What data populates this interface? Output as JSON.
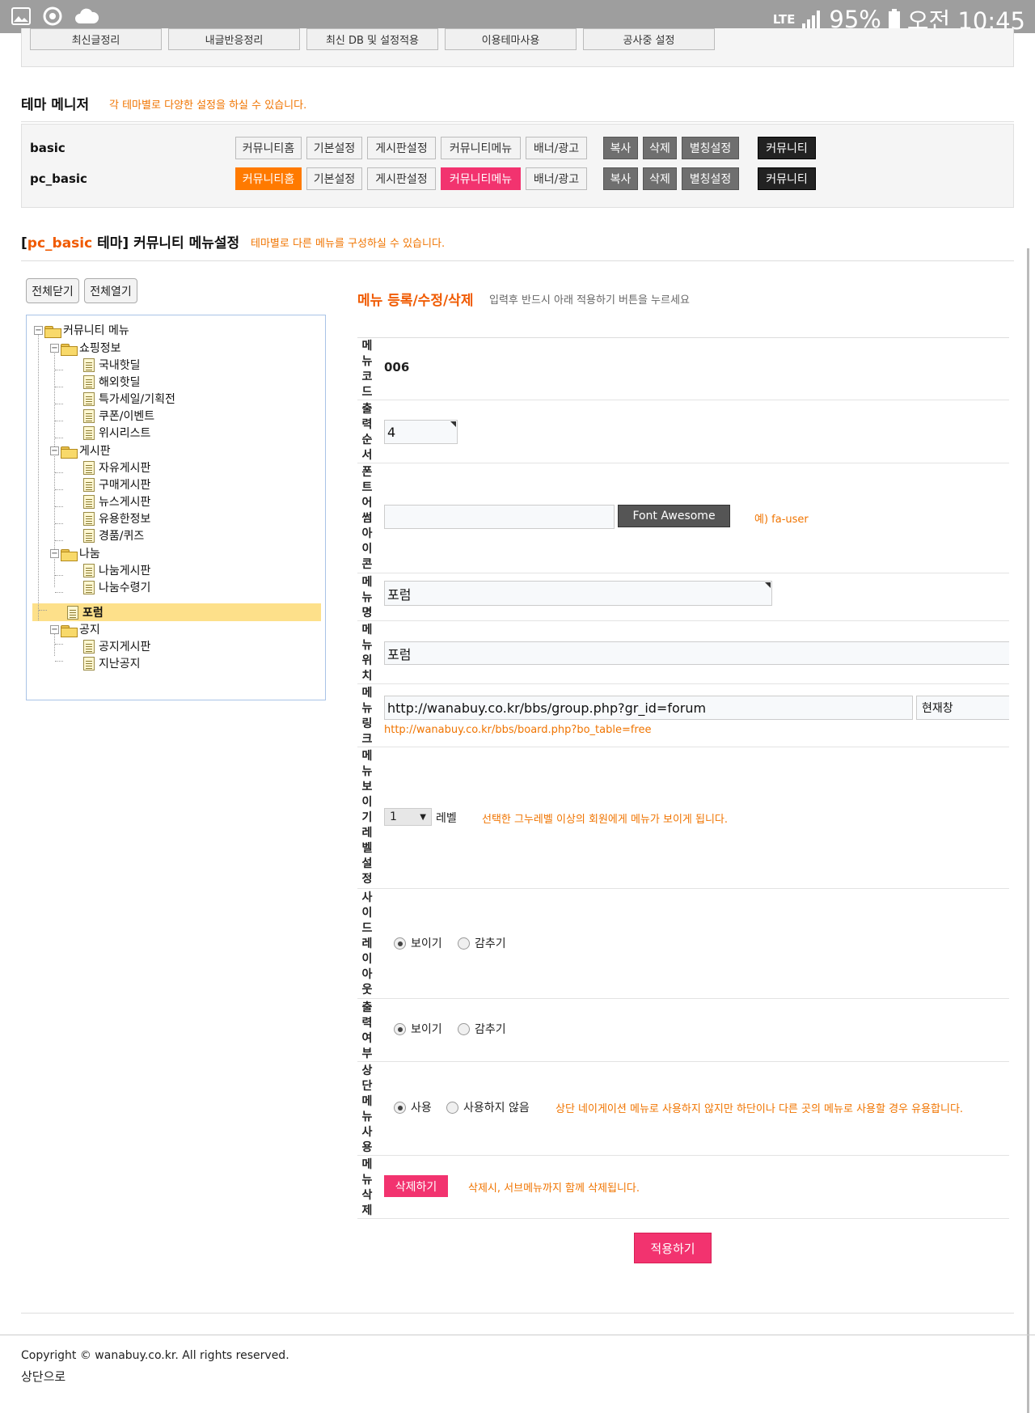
{
  "statusbar": {
    "network": "LTE",
    "battery": "95%",
    "time": "오전 10:45"
  },
  "top_buttons": [
    "최신글정리",
    "내글반응정리",
    "최신 DB 및 설정적용",
    "이용테마사용",
    "공사중 설정"
  ],
  "theme_manager": {
    "title": "테마 메니저",
    "note": "각 테마별로 다양한 설정을 하실 수 있습니다.",
    "rows": [
      {
        "name": "basic",
        "buttons": [
          "커뮤니티홈",
          "기본설정",
          "게시판설정",
          "커뮤니티메뉴",
          "배너/광고"
        ],
        "actions": [
          "복사",
          "삭제",
          "별칭설정"
        ],
        "link": "커뮤니티"
      },
      {
        "name": "pc_basic",
        "buttons": [
          "커뮤니티홈",
          "기본설정",
          "게시판설정",
          "커뮤니티메뉴",
          "배너/광고"
        ],
        "actions": [
          "복사",
          "삭제",
          "별칭설정"
        ],
        "link": "커뮤니티"
      }
    ]
  },
  "menu_setting": {
    "bracket_open": "[",
    "theme_name": "pc_basic",
    "title_rest": " 테마] 커뮤니티 메뉴설정",
    "note": "테마별로 다른 메뉴를 구성하실 수 있습니다."
  },
  "tree_controls": {
    "collapse_all": "전체닫기",
    "expand_all": "전체열기"
  },
  "tree": {
    "root": "커뮤니티 메뉴",
    "items": [
      "쇼핑정보",
      "국내핫딜",
      "해외핫딜",
      "특가세일/기획전",
      "쿠폰/이벤트",
      "위시리스트",
      "게시판",
      "자유게시판",
      "구매게시판",
      "뉴스게시판",
      "유용한정보",
      "경품/퀴즈",
      "나눔",
      "나눔게시판",
      "나눔수령기",
      "포럼",
      "공지",
      "공지게시판",
      "지난공지"
    ],
    "selected": "포럼"
  },
  "form": {
    "title": "메뉴 등록/수정/삭제",
    "desc": "입력후 반드시 아래 적용하기 버튼을 누르세요",
    "labels": {
      "code": "메뉴코드",
      "order": "출력순서",
      "icon": "폰트어썸아이콘",
      "name": "메뉴명",
      "position": "메뉴위치",
      "link": "메뉴링크",
      "level": "메뉴보이기레벨설정",
      "side": "사이드레이아웃",
      "output": "출력여부",
      "top": "상단메뉴사용",
      "delete": "메뉴삭제"
    },
    "menu_code": "006",
    "order_value": "4",
    "icon_value": "",
    "icon_button": "Font Awesome",
    "icon_hint": "예) fa-user",
    "menu_name": "포럼",
    "menu_position": "포럼",
    "menu_link": "http://wanabuy.co.kr/bbs/group.php?gr_id=forum",
    "link_target": "현재창",
    "link_hint": "http://wanabuy.co.kr/bbs/board.php?bo_table=free",
    "level_value": "1",
    "level_arrow": "▼",
    "level_unit": "레벨",
    "level_hint": "선택한 그누레벨 이상의 회원에게 메뉴가 보이게 됩니다.",
    "side_options": [
      "보이기",
      "감추기"
    ],
    "output_options": [
      "보이기",
      "감추기"
    ],
    "top_options": [
      "사용",
      "사용하지 않음"
    ],
    "top_hint": "상단 네이게이션 메뉴로 사용하지 않지만 하단이나 다른 곳의 메뉴로 사용할 경우 유용합니다.",
    "delete_button": "삭제하기",
    "delete_hint": "삭제시, 서브메뉴까지 함께 삭제됩니다.",
    "apply_button": "적용하기"
  },
  "footer": {
    "copyright": "Copyright © wanabuy.co.kr. All rights reserved.",
    "top_link": "상단으로"
  }
}
